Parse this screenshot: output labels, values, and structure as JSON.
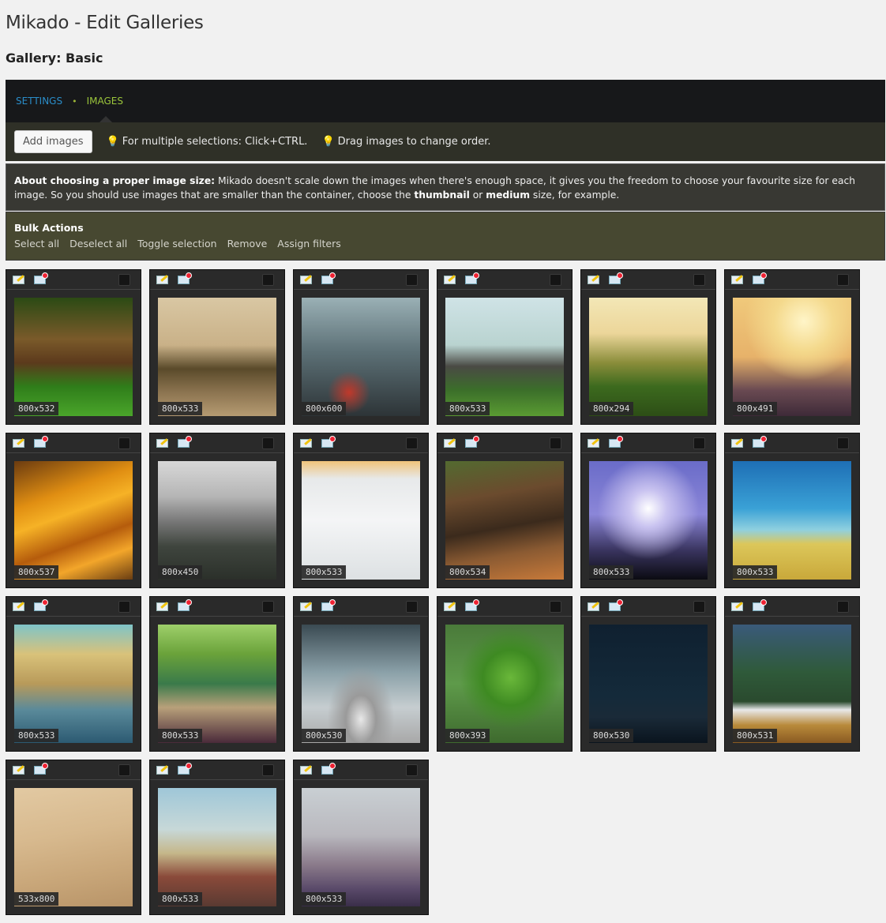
{
  "page": {
    "title": "Mikado - Edit Galleries",
    "gallery_title": "Gallery: Basic"
  },
  "tabs": {
    "settings": "SETTINGS",
    "separator": "•",
    "images": "IMAGES",
    "active": "images"
  },
  "toolbar": {
    "add_images": "Add images",
    "hint_multi": "For multiple selections: Click+CTRL.",
    "hint_drag": "Drag images to change order."
  },
  "info": {
    "heading": "About choosing a proper image size:",
    "text1": " Mikado doesn't scale down the images when there's enough space, it gives you the freedom to choose your favourite size for each image. So you should use images that are smaller than the container, choose the ",
    "bold1": "thumbnail",
    "text2": " or ",
    "bold2": "medium",
    "text3": " size, for example."
  },
  "bulk": {
    "title": "Bulk Actions",
    "select_all": "Select all",
    "deselect_all": "Deselect all",
    "toggle_selection": "Toggle selection",
    "remove": "Remove",
    "assign_filters": "Assign filters"
  },
  "colors": {
    "tab_settings": "#2a8dc9",
    "tab_images": "#9bc53b",
    "bulk_bg": "#474831",
    "toolbar_bg": "#2f3027"
  },
  "images": [
    {
      "size": "800x532",
      "bg": "linear-gradient(180deg,#2b4a14 0%,#7a5a2a 35%,#5c3a1c 55%,#2f7d1a 75%,#4aa52a 100%)"
    },
    {
      "size": "800x533",
      "bg": "linear-gradient(180deg,#d9c7a3 0%,#c9b188 40%,#5a4a2a 60%,#8c7450 80%,#b59b72 100%)"
    },
    {
      "size": "800x600",
      "bg": "radial-gradient(circle at 40% 80%,#c0392b 0%,transparent 18%),linear-gradient(180deg,#9ab0b5 0%,#5d7177 45%,#2d3437 100%)"
    },
    {
      "size": "800x533",
      "bg": "linear-gradient(180deg,#cfe3e6 0%,#b9d3d0 40%,#4a4a44 58%,#3b6e2a 78%,#5a9b32 100%)"
    },
    {
      "size": "800x294",
      "bg": "linear-gradient(180deg,#f3e7b6 0%,#ecd69a 30%,#8a8d3a 55%,#3c6a1e 75%,#2d4e16 100%)"
    },
    {
      "size": "800x491",
      "bg": "radial-gradient(circle at 60% 20%,#fff5c8 0%,#f4d98c 25%,transparent 50%),linear-gradient(180deg,#f0c97b 0%,#e7b26a 50%,#6a4a52 78%,#3e2a38 100%)"
    },
    {
      "size": "800x537",
      "bg": "linear-gradient(160deg,#6b3b10 0%,#e08e12 30%,#f6b226 45%,#b55c0c 65%,#f3a62a 80%,#6a3d12 100%)"
    },
    {
      "size": "800x450",
      "bg": "linear-gradient(180deg,#d8d8d8 0%,#b5b5b5 30%,#7a7a7a 50%,#3f453e 72%,#2b302a 100%)"
    },
    {
      "size": "800x533",
      "bg": "linear-gradient(180deg,#f0c37a 0%,#e7e9ea 15%,#f4f5f6 50%,#dde1e3 100%)"
    },
    {
      "size": "800x534",
      "bg": "linear-gradient(170deg,#536a30 0%,#6b4b2e 30%,#3b2a1c 55%,#8a5a32 75%,#c87a3a 100%)"
    },
    {
      "size": "800x533",
      "bg": "radial-gradient(circle at 50% 40%,#ffffff 0%,#c9c3f0 20%,transparent 55%),linear-gradient(180deg,#6a6cc8 0%,#8b86d8 45%,#3a3560 75%,#0b0b12 100%)"
    },
    {
      "size": "800x533",
      "bg": "linear-gradient(180deg,#1e6fb5 0%,#3aa1d6 40%,#8fd0df 58%,#dcc75a 70%,#c9a83a 100%)"
    },
    {
      "size": "800x533",
      "bg": "linear-gradient(180deg,#7fc4c8 0%,#d9c27a 25%,#b89a5a 50%,#5a8a9a 72%,#2c5a72 100%)"
    },
    {
      "size": "800x533",
      "bg": "linear-gradient(180deg,#9ecf6a 0%,#6aa23a 25%,#3a7a4a 50%,#b8a07a 70%,#4a2a3a 100%)"
    },
    {
      "size": "800x530",
      "bg": "radial-gradient(ellipse at 50% 80%,#e8e8e8 0%,#9a9a9a 18%,transparent 40%),linear-gradient(180deg,#3a4a52 0%,#8aa0a8 40%,#c6cdd0 70%,#a8a8a8 100%)"
    },
    {
      "size": "800x393",
      "bg": "radial-gradient(ellipse at 55% 45%,#6ab83a 0%,#3e8a22 30%,transparent 55%),linear-gradient(180deg,#4a7a3a 0%,#5e9a4a 50%,#3e6a2e 100%)"
    },
    {
      "size": "800x530",
      "bg": "linear-gradient(180deg,#0f2030 0%,#142a3a 60%,#1a2a38 78%,#0a141e 100%)"
    },
    {
      "size": "800x531",
      "bg": "linear-gradient(180deg,#3a5a7a 0%,#2f5a3a 40%,#2a4a2e 65%,#e8e8ea 72%,#b88a3a 85%,#8a5a22 100%)"
    },
    {
      "size": "533x800",
      "bg": "linear-gradient(170deg,#e2c9a2 0%,#d7b98e 40%,#c9a77a 70%,#b89468 100%)"
    },
    {
      "size": "800x533",
      "bg": "linear-gradient(180deg,#9fc7d8 0%,#c7d8d8 35%,#c5b78a 55%,#8a4a3a 75%,#5a3a32 100%)"
    },
    {
      "size": "800x533",
      "bg": "linear-gradient(180deg,#c9cfd3 0%,#b9b8be 40%,#8a7a8a 65%,#5a4a6a 85%,#3a2e4a 100%)"
    }
  ]
}
